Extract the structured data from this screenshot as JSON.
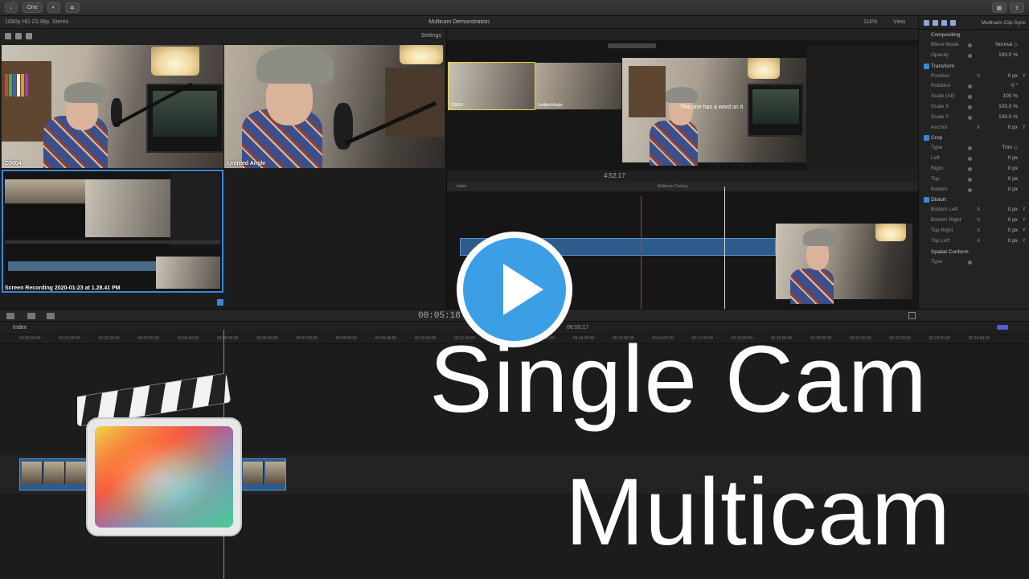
{
  "toolbar": {
    "btn1": "↓",
    "btn2": "One",
    "btn3": "◐",
    "btn4": "✲"
  },
  "viewer": {
    "format": "1080p HD 23.98p, Stereo",
    "project_title": "Multicam Demonstration",
    "zoom": "116%",
    "view_label": "View"
  },
  "angle_viewer": {
    "settings_label": "Settings",
    "angles": [
      {
        "label": "C0004"
      },
      {
        "label": "Untitled Angle"
      },
      {
        "label": "Screen Recording 2020-01-23 at 1.28.41 PM"
      }
    ]
  },
  "nested": {
    "clip_label_1": "C0003",
    "clip_label_2": "Untitled Angle",
    "caption": "This one has a word on it",
    "timecode": "4:52:17",
    "index_label": "Index",
    "project_label": "Multicam Testing"
  },
  "inspector": {
    "title": "Multicam Clip Sync",
    "rows": [
      {
        "type": "sec",
        "label": "Compositing",
        "check": false
      },
      {
        "type": "row",
        "label": "Blend Mode",
        "val": "Normal ◇"
      },
      {
        "type": "row",
        "label": "Opacity",
        "val": "100.0 %"
      },
      {
        "type": "sec",
        "label": "Transform",
        "check": true
      },
      {
        "type": "row",
        "label": "Position",
        "axis": "X",
        "val": "0 px",
        "end": "Y"
      },
      {
        "type": "row",
        "label": "Rotation",
        "val": "0 °"
      },
      {
        "type": "row",
        "label": "Scale (All)",
        "val": "100 %"
      },
      {
        "type": "row",
        "label": "Scale X",
        "val": "100.0 %"
      },
      {
        "type": "row",
        "label": "Scale Y",
        "val": "100.0 %"
      },
      {
        "type": "row",
        "label": "Anchor",
        "axis": "X",
        "val": "0 px",
        "end": "Y"
      },
      {
        "type": "sec",
        "label": "Crop",
        "check": true
      },
      {
        "type": "row",
        "label": "Type",
        "val": "Trim ◇"
      },
      {
        "type": "row",
        "label": "Left",
        "val": "0 px"
      },
      {
        "type": "row",
        "label": "Right",
        "val": "0 px"
      },
      {
        "type": "row",
        "label": "Top",
        "val": "0 px"
      },
      {
        "type": "row",
        "label": "Bottom",
        "val": "0 px"
      },
      {
        "type": "sec",
        "label": "Distort",
        "check": true
      },
      {
        "type": "row",
        "label": "Bottom Left",
        "axis": "X",
        "val": "0 px",
        "end": "Y"
      },
      {
        "type": "row",
        "label": "Bottom Right",
        "axis": "X",
        "val": "0 px",
        "end": "Y"
      },
      {
        "type": "row",
        "label": "Top Right",
        "axis": "X",
        "val": "0 px",
        "end": "Y"
      },
      {
        "type": "row",
        "label": "Top Left",
        "axis": "X",
        "val": "0 px",
        "end": "Y"
      },
      {
        "type": "sec",
        "label": "Spatial Conform",
        "check": false
      },
      {
        "type": "row",
        "label": "Type",
        "val": ""
      }
    ]
  },
  "timeline": {
    "timecode": "00:05:18",
    "index_label": "Index",
    "mid_timecode": "06:50:17",
    "ruler": [
      "00:00:00:00",
      "00:01:00:00",
      "00:02:00:00",
      "00:03:00:00",
      "00:04:00:00",
      "00:05:00:00",
      "00:06:00:00",
      "00:07:00:00",
      "00:08:00:00",
      "00:09:00:00",
      "00:10:00:00",
      "00:11:00:00",
      "00:12:00:00",
      "00:13:00:00",
      "00:14:00:00",
      "00:15:00:00",
      "00:16:00:00",
      "00:17:00:00",
      "00:18:00:00",
      "00:19:00:00",
      "00:20:00:00",
      "00:21:00:00",
      "00:22:00:00",
      "00:23:00:00",
      "00:24:00:00"
    ]
  },
  "overlay": {
    "line1": "Single Cam",
    "line2": "Multicam"
  },
  "colors": {
    "play_blue": "#3c9fe6",
    "angle_active": "#35c45b",
    "angle_selected": "#3b86d6"
  }
}
